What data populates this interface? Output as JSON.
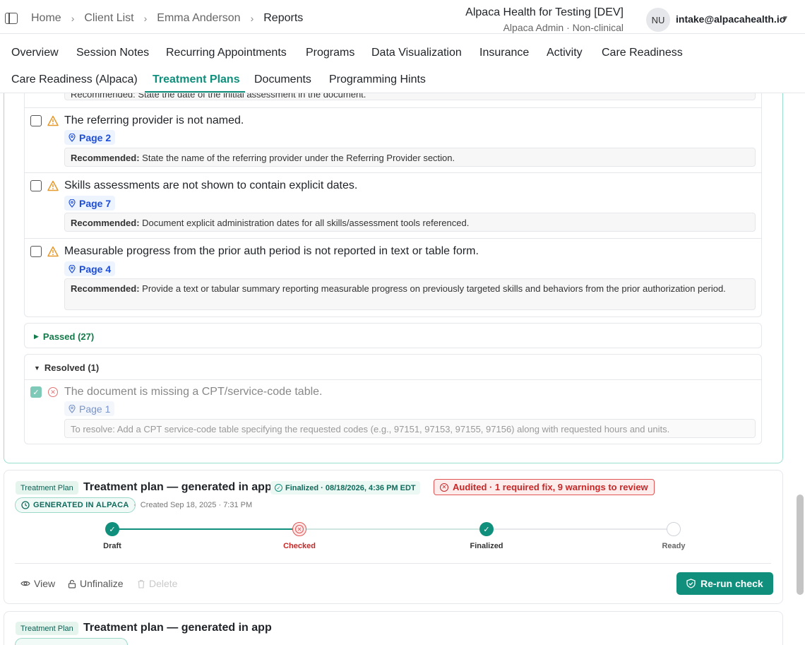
{
  "breadcrumb": [
    "Home",
    "Client List",
    "Emma Anderson",
    "Reports"
  ],
  "org": {
    "name": "Alpaca Health for Testing [DEV]",
    "role": "Alpaca Admin · Non-clinical"
  },
  "user": {
    "initials": "NU",
    "email": "intake@alpacahealth.io"
  },
  "tabs": [
    "Overview",
    "Session Notes",
    "Recurring Appointments",
    "Programs",
    "Data Visualization",
    "Insurance",
    "Activity",
    "Care Readiness",
    "Care Readiness (Alpaca)",
    "Treatment Plans",
    "Documents",
    "Programming Hints"
  ],
  "active_tab": "Treatment Plans",
  "cutoff_rec": "Recommended: State the date of the initial assessment in the document.",
  "issues": [
    {
      "text": "The referring provider is not named.",
      "page": "Page 2",
      "rec_label": "Recommended:",
      "rec": "State the name of the referring provider under the Referring Provider section."
    },
    {
      "text": "Skills assessments are not shown to contain explicit dates.",
      "page": "Page 7",
      "rec_label": "Recommended:",
      "rec": "Document explicit administration dates for all skills/assessment tools referenced."
    },
    {
      "text": "Measurable progress from the prior auth period is not reported in text or table form.",
      "page": "Page 4",
      "rec_label": "Recommended:",
      "rec": "Provide a text or tabular summary reporting measurable progress on previously targeted skills and behaviors from the prior authorization period."
    }
  ],
  "passed": {
    "label": "Passed (27)"
  },
  "resolved": {
    "label": "Resolved (1)",
    "item": {
      "text": "The document is missing a CPT/service-code table.",
      "page": "Page 1",
      "rec": "To resolve: Add a CPT service-code table specifying the requested codes (e.g., 97151, 97153, 97155, 97156) along with requested hours and units."
    }
  },
  "plan1": {
    "tag": "Treatment Plan",
    "title": "Treatment plan — generated in app",
    "finalized": "Finalized · 08/18/2026, 4:36 PM EDT",
    "audit": "Audited · 1 required fix, 9 warnings to review",
    "generated": "GENERATED IN ALPACA",
    "created": "Created Sep 18, 2025 · 7:31 PM",
    "steps": [
      "Draft",
      "Checked",
      "Finalized",
      "Ready"
    ],
    "actions": {
      "view": "View",
      "unfinalize": "Unfinalize",
      "delete": "Delete"
    },
    "rerun": "Re-run check"
  },
  "plan2": {
    "tag": "Treatment Plan",
    "title": "Treatment plan — generated in app"
  },
  "colors": {
    "accent": "#0f8f7c",
    "error": "#e25555",
    "warning": "#e69a2e",
    "link": "#1d4ed8"
  },
  "icons": [
    "sidebar-toggle-icon",
    "chevron-right-icon",
    "warning-triangle-icon",
    "map-pin-icon",
    "x-circle-icon",
    "check-icon",
    "eye-icon",
    "lock-icon",
    "trash-icon",
    "shield-check-icon"
  ]
}
